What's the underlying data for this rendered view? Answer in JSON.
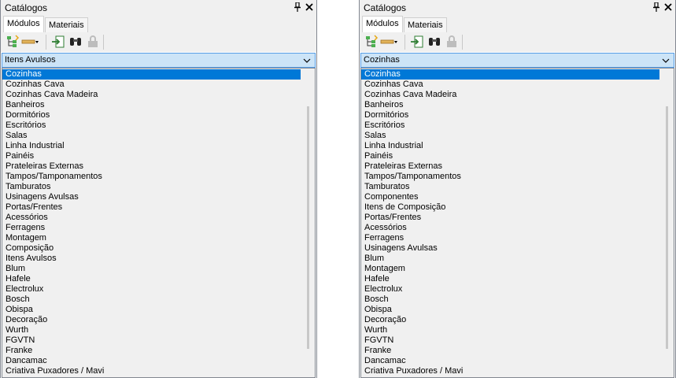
{
  "panels": [
    {
      "title": "Catálogos",
      "tabs": [
        "Módulos",
        "Materiais"
      ],
      "combo_value": "Itens Avulsos",
      "items": [
        "Cozinhas",
        "Cozinhas Cava",
        "Cozinhas Cava Madeira",
        "Banheiros",
        "Dormitórios",
        "Escritórios",
        "Salas",
        "Linha Industrial",
        "Painéis",
        "Prateleiras Externas",
        "Tampos/Tamponamentos",
        "Tamburatos",
        "Usinagens Avulsas",
        "Portas/Frentes",
        "Acessórios",
        "Ferragens",
        "Montagem",
        "Composição",
        "Itens Avulsos",
        "Blum",
        "Hafele",
        "Electrolux",
        "Bosch",
        "Obispa",
        "Decoração",
        "Wurth",
        "FGVTN",
        "Franke",
        "Dancamac",
        "Criativa Puxadores / Mavi"
      ],
      "selected_item": "Cozinhas"
    },
    {
      "title": "Catálogos",
      "tabs": [
        "Módulos",
        "Materiais"
      ],
      "combo_value": "Cozinhas",
      "items": [
        "Cozinhas",
        "Cozinhas Cava",
        "Cozinhas Cava Madeira",
        "Banheiros",
        "Dormitórios",
        "Escritórios",
        "Salas",
        "Linha Industrial",
        "Painéis",
        "Prateleiras Externas",
        "Tampos/Tamponamentos",
        "Tamburatos",
        "Componentes",
        "Itens de Composição",
        "Portas/Frentes",
        "Acessórios",
        "Ferragens",
        "Usinagens Avulsas",
        "Blum",
        "Montagem",
        "Hafele",
        "Electrolux",
        "Bosch",
        "Obispa",
        "Decoração",
        "Wurth",
        "FGVTN",
        "Franke",
        "Dancamac",
        "Criativa Puxadores / Mavi"
      ],
      "selected_item": "Cozinhas"
    }
  ],
  "icons": [
    "pin-icon",
    "close-icon",
    "tree-icon",
    "ruler-icon",
    "dropdown-arrow-icon",
    "import-icon",
    "binoculars-icon",
    "lock-icon",
    "chevron-down-icon"
  ],
  "colors": {
    "selection": "#0078d7",
    "combo_bg": "#cce4f7",
    "combo_border": "#569de5",
    "list_bg": "#f0f0f0"
  }
}
